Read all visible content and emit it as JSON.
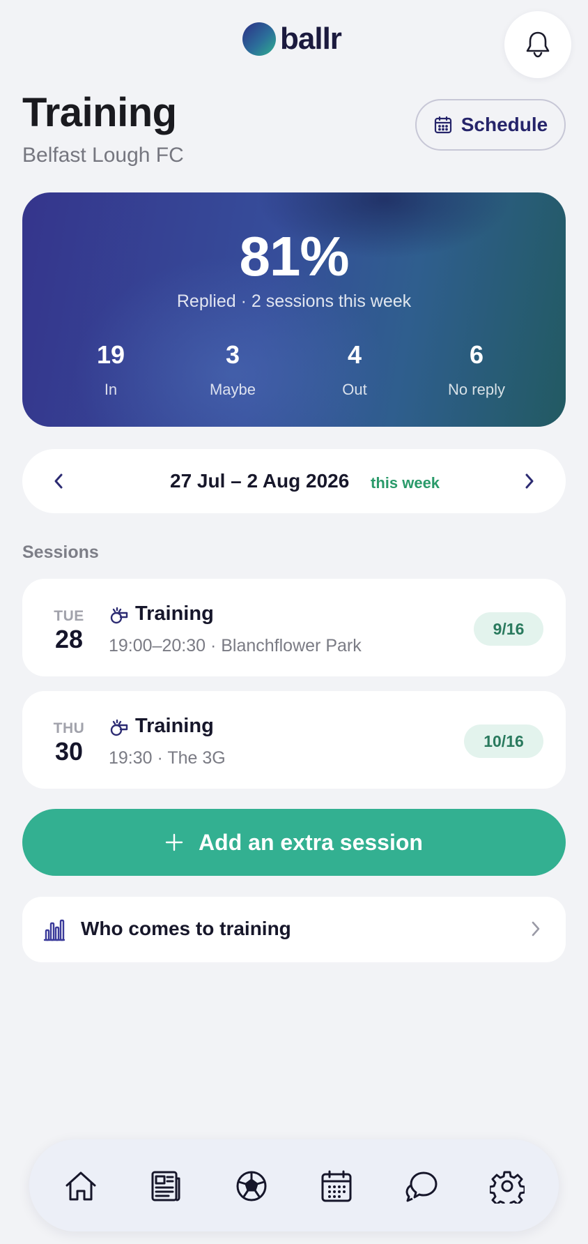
{
  "header": {
    "logo_text": "ballr",
    "notifications_icon": "bell-icon"
  },
  "page": {
    "title": "Training",
    "subtitle": "Belfast Lough FC",
    "schedule_button": "Schedule",
    "schedule_icon": "calendar-icon"
  },
  "summary": {
    "percent": "81%",
    "caption": "Replied · 2 sessions this week",
    "stats": [
      {
        "value": "19",
        "label": "In"
      },
      {
        "value": "3",
        "label": "Maybe"
      },
      {
        "value": "4",
        "label": "Out"
      },
      {
        "value": "6",
        "label": "No reply"
      }
    ]
  },
  "week": {
    "range": "27 Jul – 2 Aug 2026",
    "tag": "this week"
  },
  "sessions_label": "Sessions",
  "sessions": [
    {
      "dow": "TUE",
      "day": "28",
      "title": "Training",
      "meta": "19:00–20:30 · Blanchflower Park",
      "attendance": "9/16"
    },
    {
      "dow": "THU",
      "day": "30",
      "title": "Training",
      "meta": "19:30 · The 3G",
      "attendance": "10/16"
    }
  ],
  "add_session_button": "Add an extra session",
  "who_comes": {
    "label": "Who comes to training",
    "icon": "bar-chart-icon"
  },
  "bottom_nav": [
    "home-icon",
    "news-icon",
    "football-icon",
    "calendar-icon",
    "chat-icon",
    "settings-icon"
  ],
  "colors": {
    "accent_green": "#33b091",
    "brand_navy": "#25246a",
    "badge_bg": "#e3f3ed"
  }
}
